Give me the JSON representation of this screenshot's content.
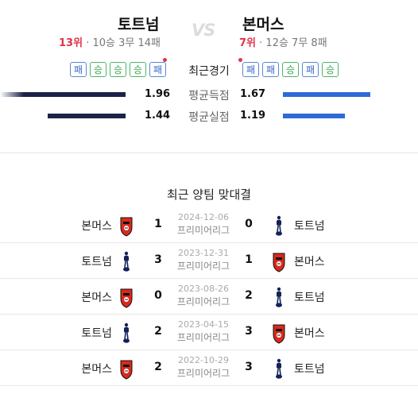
{
  "home_team": {
    "name": "토트넘",
    "rank": "13위",
    "record": "· 10승 3무 14패"
  },
  "away_team": {
    "name": "본머스",
    "rank": "7위",
    "record": "· 12승 7무 8패"
  },
  "vs_label": "VS",
  "recent_form": {
    "label": "최근경기",
    "home": [
      "패",
      "승",
      "승",
      "승",
      "패"
    ],
    "away": [
      "패",
      "패",
      "승",
      "패",
      "승"
    ]
  },
  "stats": [
    {
      "label": "평균득점",
      "home": "1.96",
      "away": "1.67"
    },
    {
      "label": "평균실점",
      "home": "1.44",
      "away": "1.19"
    }
  ],
  "h2h": {
    "title": "최근 양팀 맞대결",
    "matches": [
      {
        "home": "본머스",
        "home_score": "1",
        "away_score": "0",
        "away": "토트넘",
        "date": "2024-12-06",
        "competition": "프리미어리그"
      },
      {
        "home": "토트넘",
        "home_score": "3",
        "away_score": "1",
        "away": "본머스",
        "date": "2023-12-31",
        "competition": "프리미어리그"
      },
      {
        "home": "본머스",
        "home_score": "0",
        "away_score": "2",
        "away": "토트넘",
        "date": "2023-08-26",
        "competition": "프리미어리그"
      },
      {
        "home": "토트넘",
        "home_score": "2",
        "away_score": "3",
        "away": "본머스",
        "date": "2023-04-15",
        "competition": "프리미어리그"
      },
      {
        "home": "본머스",
        "home_score": "2",
        "away_score": "3",
        "away": "토트넘",
        "date": "2022-10-29",
        "competition": "프리미어리그"
      }
    ]
  },
  "colors": {
    "rank_red": "#e0334a",
    "loss_blue": "#3366cc",
    "win_green": "#2fa84f",
    "home_bar": "#1c2347",
    "away_bar": "#2f6bd6"
  }
}
